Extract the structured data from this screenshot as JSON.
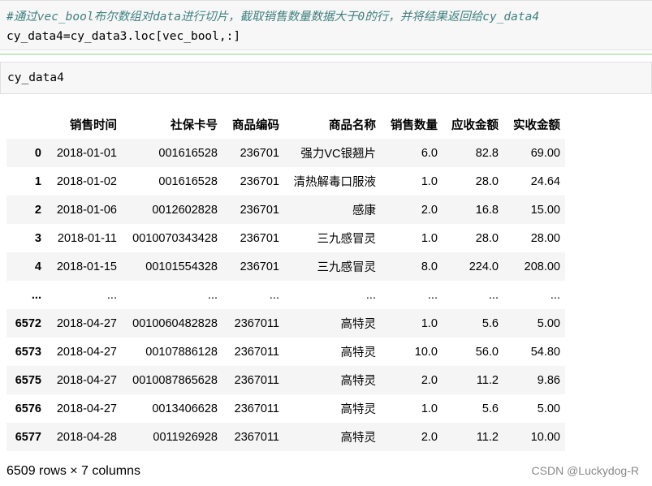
{
  "cells": {
    "cell1_comment": "#通过vec_bool布尔数组对data进行切片，截取销售数量数据大于0的行，并将结果返回给cy_data4",
    "cell1_code": "cy_data4=cy_data3.loc[vec_bool,:]",
    "cell2_code": "cy_data4"
  },
  "dataframe": {
    "columns": [
      "",
      "销售时间",
      "社保卡号",
      "商品编码",
      "商品名称",
      "销售数量",
      "应收金额",
      "实收金额"
    ],
    "rows": [
      [
        "0",
        "2018-01-01",
        "001616528",
        "236701",
        "强力VC银翘片",
        "6.0",
        "82.8",
        "69.00"
      ],
      [
        "1",
        "2018-01-02",
        "001616528",
        "236701",
        "清热解毒口服液",
        "1.0",
        "28.0",
        "24.64"
      ],
      [
        "2",
        "2018-01-06",
        "0012602828",
        "236701",
        "感康",
        "2.0",
        "16.8",
        "15.00"
      ],
      [
        "3",
        "2018-01-11",
        "0010070343428",
        "236701",
        "三九感冒灵",
        "1.0",
        "28.0",
        "28.00"
      ],
      [
        "4",
        "2018-01-15",
        "00101554328",
        "236701",
        "三九感冒灵",
        "8.0",
        "224.0",
        "208.00"
      ],
      [
        "...",
        "...",
        "...",
        "...",
        "...",
        "...",
        "...",
        "..."
      ],
      [
        "6572",
        "2018-04-27",
        "0010060482828",
        "2367011",
        "高特灵",
        "1.0",
        "5.6",
        "5.00"
      ],
      [
        "6573",
        "2018-04-27",
        "00107886128",
        "2367011",
        "高特灵",
        "10.0",
        "56.0",
        "54.80"
      ],
      [
        "6575",
        "2018-04-27",
        "0010087865628",
        "2367011",
        "高特灵",
        "2.0",
        "11.2",
        "9.86"
      ],
      [
        "6576",
        "2018-04-27",
        "0013406628",
        "2367011",
        "高特灵",
        "1.0",
        "5.6",
        "5.00"
      ],
      [
        "6577",
        "2018-04-28",
        "0011926928",
        "2367011",
        "高特灵",
        "2.0",
        "11.2",
        "10.00"
      ]
    ],
    "shape_text": "6509 rows × 7 columns"
  },
  "watermark": "CSDN @Luckydog-R"
}
